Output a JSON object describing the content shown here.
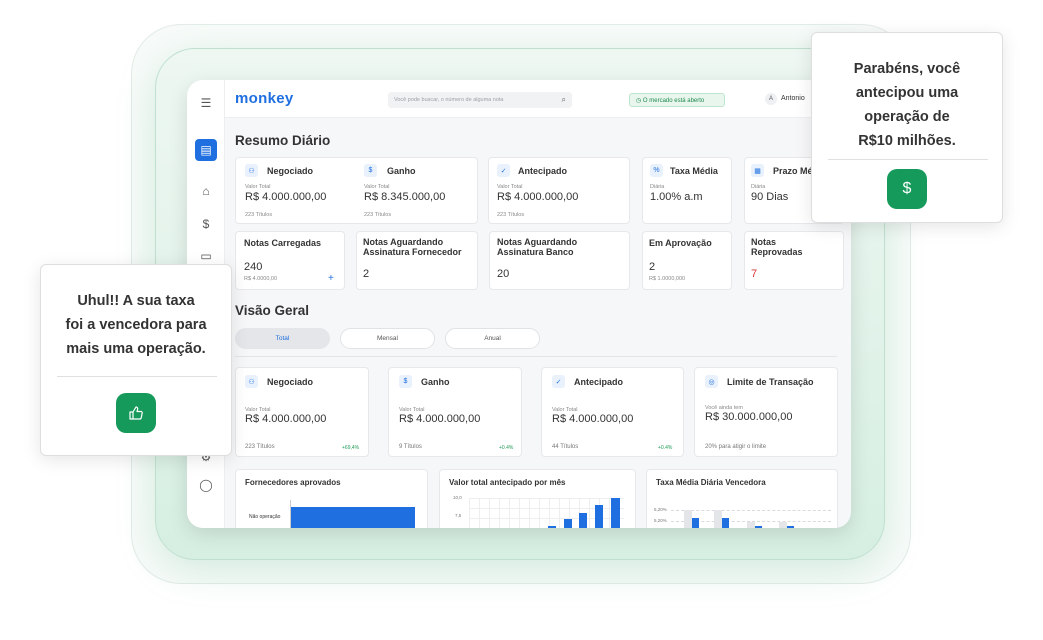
{
  "app": {
    "logo": "monkey",
    "search_placeholder": "Você pode buscar, o número de alguma nota",
    "market_status": "O mercado está aberto",
    "user_initial": "A",
    "user_name": "Antonio"
  },
  "resumo": {
    "title": "Resumo Diário",
    "cards": [
      {
        "title": "Negociado",
        "label": "Valor Total",
        "value": "R$ 4.000.000,00",
        "sub": "223 Títulos"
      },
      {
        "title": "Ganho",
        "label": "Valor Total",
        "value": "R$ 8.345.000,00",
        "sub": "223 Títulos"
      },
      {
        "title": "Antecipado",
        "label": "Valor Total",
        "value": "R$ 4.000.000,00",
        "sub": "223 Títulos"
      },
      {
        "title": "Taxa Média",
        "label": "Diária",
        "value": "1.00% a.m"
      },
      {
        "title": "Prazo Mé",
        "label": "Diária",
        "value": "90 Dias"
      }
    ],
    "notes": [
      {
        "title": "Notas Carregadas",
        "value": "240",
        "sub": "R$ 4.0000,00",
        "action": "+"
      },
      {
        "title": "Notas Aguardando Assinatura Fornecedor",
        "value": "2"
      },
      {
        "title": "Notas Aguardando Assinatura Banco",
        "value": "20"
      },
      {
        "title": "Em Aprovação",
        "value": "2",
        "sub": "R$ 1.0000,000"
      },
      {
        "title": "Notas Reprovadas",
        "value": "7"
      }
    ]
  },
  "visao": {
    "title": "Visão Geral",
    "tabs": [
      "Total",
      "Mensal",
      "Anual"
    ],
    "cards": [
      {
        "title": "Negociado",
        "label": "Valor Total",
        "value": "R$ 4.000.000,00",
        "sub": "223 Títulos",
        "delta": "+69,4%"
      },
      {
        "title": "Ganho",
        "label": "Valor Total",
        "value": "R$ 4.000.000,00",
        "sub": "9 Títulos",
        "delta": "+0.4%"
      },
      {
        "title": "Antecipado",
        "label": "Valor Total",
        "value": "R$ 4.000.000,00",
        "sub": "44 Títulos",
        "delta": "+0.4%"
      },
      {
        "title": "Limite de Transação",
        "label": "Você ainda tem",
        "value": "R$ 30.000.000,00",
        "sub": "20% para atigir o limite"
      }
    ]
  },
  "charts": {
    "fornecedores": {
      "title": "Fornecedores aprovados",
      "category": "Não operação"
    },
    "valor": {
      "title": "Valor total antecipado por mês",
      "ytick1": "10,0",
      "ytick2": "7,5"
    },
    "taxa": {
      "title": "Taxa Média Diária Vencedora",
      "ytick1": "5,20%",
      "ytick2": "5,20%"
    }
  },
  "popup_right": {
    "lines": [
      "Parabéns, você",
      "antecipou uma",
      "operação de",
      "R$10 milhões."
    ]
  },
  "popup_left": {
    "lines": [
      "Uhul!! A sua taxa",
      "foi a vencedora para",
      "mais uma operação."
    ]
  },
  "colors": {
    "accent": "#1f6fe0",
    "green": "#169a5b"
  }
}
